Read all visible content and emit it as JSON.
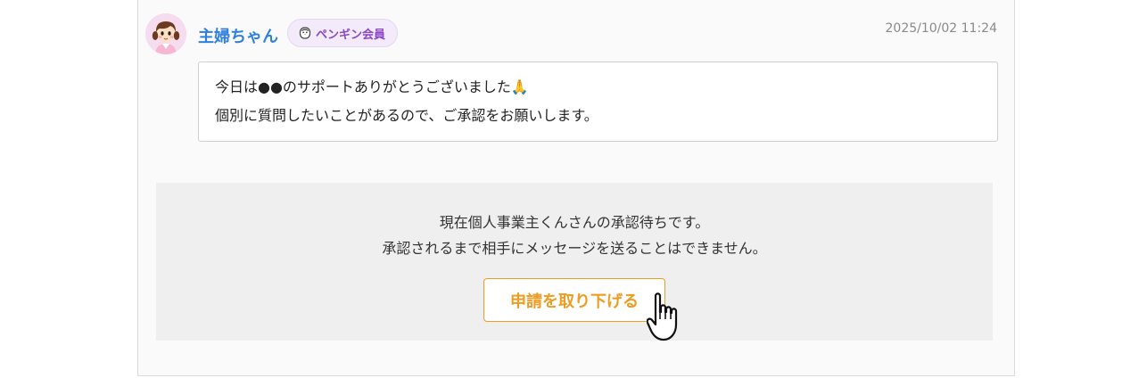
{
  "message": {
    "user_name": "主婦ちゃん",
    "member_badge": {
      "label": "ペンギン会員",
      "icon": "penguin-icon"
    },
    "timestamp": "2025/10/02 11:24",
    "lines": [
      "今日は●●のサポートありがとうございました🙏",
      "個別に質問したいことがあるので、ご承認をお願いします。"
    ]
  },
  "notice": {
    "line1": "現在個人事業主くんさんの承認待ちです。",
    "line2": "承認されるまで相手にメッセージを送ることはできません。"
  },
  "withdraw_button": {
    "label": "申請を取り下げる"
  },
  "colors": {
    "user_name": "#2f7fde",
    "badge_text": "#8a48c8",
    "badge_background": "#f3ebfa",
    "button_accent": "#ee9c22",
    "notice_background": "#efefef"
  },
  "icons": {
    "avatar": "avatar",
    "cursor": "hand-cursor-icon"
  }
}
